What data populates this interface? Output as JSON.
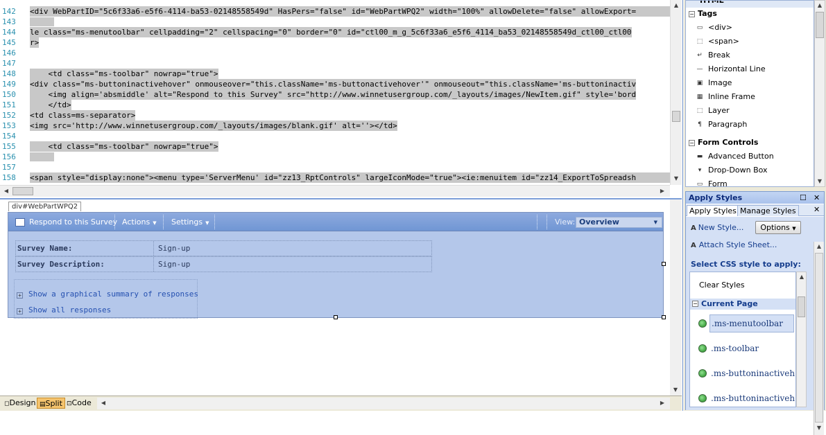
{
  "code_lines": [
    {
      "num": "142",
      "text": "<div WebPartID=\"5c6f33a6-e5f6-4114-ba53-02148558549d\" HasPers=\"false\" id=\"WebPartWPQ2\" width=\"100%\" allowDelete=\"false\" allowExport="
    },
    {
      "num": "143",
      "text": ""
    },
    {
      "num": "144",
      "text": "le class=\"ms-menutoolbar\" cellpadding=\"2\" cellspacing=\"0\" border=\"0\" id=\"ctl00_m_g_5c6f33a6_e5f6_4114_ba53_02148558549d_ctl00_ctl00"
    },
    {
      "num": "145",
      "text": "r>"
    },
    {
      "num": "146",
      "text": ""
    },
    {
      "num": "147",
      "text": ""
    },
    {
      "num": "148",
      "text": "    <td class=\"ms-toolbar\" nowrap=\"true\">"
    },
    {
      "num": "149",
      "text": "<div class=\"ms-buttoninactivehover\" onmouseover=\"this.className='ms-buttonactivehover'\" onmouseout=\"this.className='ms-buttoninactiv"
    },
    {
      "num": "150",
      "text": "    <img align='absmiddle' alt=\"Respond to this Survey\" src=\"http://www.winnetusergroup.com/_layouts/images/NewItem.gif\" style='bord"
    },
    {
      "num": "151",
      "text": "    </td>"
    },
    {
      "num": "152",
      "text": "<td class=ms-separator>"
    },
    {
      "num": "153",
      "text": "<img src='http://www.winnetusergroup.com/_layouts/images/blank.gif' alt=''></td>"
    },
    {
      "num": "154",
      "text": ""
    },
    {
      "num": "155",
      "text": "    <td class=\"ms-toolbar\" nowrap=\"true\">"
    },
    {
      "num": "156",
      "text": ""
    },
    {
      "num": "157",
      "text": ""
    },
    {
      "num": "158",
      "text": "<span style=\"display:none\"><menu type='ServerMenu' id=\"zz13_RptControls\" largeIconMode=\"true\"><ie:menuitem id=\"zz14_ExportToSpreadsh"
    }
  ],
  "design": {
    "tag_tab": "div#WebPartWPQ2",
    "toolbar": {
      "respond": "Respond to this Survey",
      "actions": "Actions",
      "settings": "Settings",
      "view_label": "View:",
      "view_value": "Overview"
    },
    "survey": {
      "name_label": "Survey Name:",
      "name_value": "Sign-up",
      "desc_label": "Survey Description:",
      "desc_value": "Sign-up"
    },
    "links": {
      "summary": "Show a graphical summary of responses",
      "all": "Show all responses"
    }
  },
  "view_buttons": {
    "design": "Design",
    "split": "Split",
    "code": "Code"
  },
  "toolbox": {
    "header_partial": "HTML",
    "tags_group": "Tags",
    "tags": [
      "<div>",
      "<span>",
      "Break",
      "Horizontal Line",
      "Image",
      "Inline Frame",
      "Layer",
      "Paragraph"
    ],
    "form_group": "Form Controls",
    "form": [
      "Advanced Button",
      "Drop-Down Box",
      "Form"
    ]
  },
  "apply_styles": {
    "title": "Apply Styles",
    "tab_apply": "Apply Styles",
    "tab_manage": "Manage Styles",
    "new_style": "New Style...",
    "options": "Options",
    "attach": "Attach Style Sheet...",
    "select_label": "Select CSS style to apply:",
    "clear": "Clear Styles",
    "current_page": "Current Page",
    "styles": [
      ".ms-menutoolbar",
      ".ms-toolbar",
      ".ms-buttoninactiveh",
      ".ms-buttoninactiveh"
    ]
  }
}
